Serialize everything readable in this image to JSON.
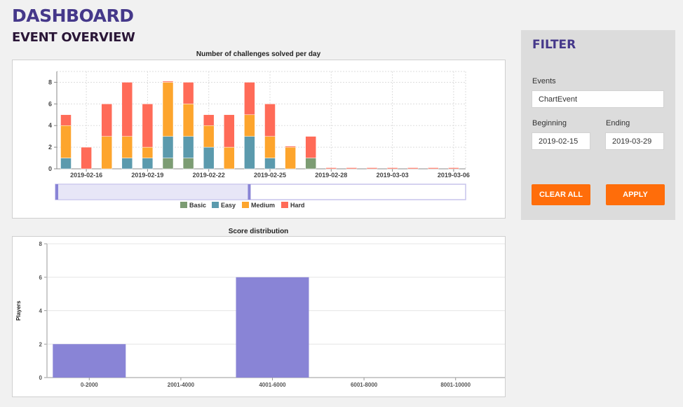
{
  "header": {
    "title": "DASHBOARD",
    "subtitle": "EVENT OVERVIEW"
  },
  "colors": {
    "Basic": "#7c9c73",
    "Easy": "#5b9aad",
    "Medium": "#fda52d",
    "Hard": "#ff6b58",
    "score_bar": "#8984d6",
    "accent": "#45388a",
    "button": "#ff6d0a"
  },
  "chart_data": [
    {
      "type": "bar",
      "stacked": true,
      "title": "Number of challenges solved per day",
      "xlabel": "",
      "ylabel": "",
      "ylim": [
        0,
        9
      ],
      "yticks": [
        0,
        2,
        4,
        6,
        8
      ],
      "grid": true,
      "legend": "bottom",
      "categories": [
        "2019-02-15",
        "2019-02-16",
        "2019-02-17",
        "2019-02-18",
        "2019-02-19",
        "2019-02-20",
        "2019-02-21",
        "2019-02-22",
        "2019-02-23",
        "2019-02-24",
        "2019-02-25",
        "2019-02-26",
        "2019-02-27",
        "2019-02-28",
        "2019-03-01",
        "2019-03-02",
        "2019-03-03",
        "2019-03-04",
        "2019-03-05",
        "2019-03-06"
      ],
      "xticks": [
        "2019-02-16",
        "2019-02-19",
        "2019-02-22",
        "2019-02-25",
        "2019-02-28",
        "2019-03-03",
        "2019-03-06"
      ],
      "series": [
        {
          "name": "Basic",
          "values": [
            0,
            0,
            0,
            0,
            0,
            1,
            1,
            0,
            0,
            0,
            0,
            0,
            1,
            0,
            0,
            0,
            0,
            0,
            0,
            0
          ]
        },
        {
          "name": "Easy",
          "values": [
            1,
            0,
            0,
            1,
            1,
            2,
            2,
            2,
            0,
            3,
            1,
            0,
            0,
            0,
            0,
            0,
            0,
            0,
            0,
            0
          ]
        },
        {
          "name": "Medium",
          "values": [
            3,
            0,
            3,
            2,
            1,
            5,
            3,
            2,
            2,
            2,
            2,
            2,
            0,
            0,
            0,
            0,
            0,
            0,
            0,
            0
          ]
        },
        {
          "name": "Hard",
          "values": [
            1,
            2,
            3,
            5,
            4,
            0.1,
            2,
            1,
            3,
            3,
            3,
            0.1,
            2,
            0.1,
            0.1,
            0.1,
            0.1,
            0.1,
            0.1,
            0.1
          ]
        }
      ],
      "brush_range": [
        "2019-02-15",
        "2019-02-24"
      ]
    },
    {
      "type": "bar",
      "title": "Score distribution",
      "xlabel": "",
      "ylabel": "Players",
      "ylim": [
        0,
        8
      ],
      "yticks": [
        0,
        2,
        4,
        6,
        8
      ],
      "grid": true,
      "categories": [
        "0-2000",
        "2001-4000",
        "4001-6000",
        "6001-8000",
        "8001-10000"
      ],
      "values": [
        2,
        0,
        6,
        0,
        0
      ]
    }
  ],
  "filter": {
    "title": "FILTER",
    "events_label": "Events",
    "events_value": "ChartEvent",
    "beginning_label": "Beginning",
    "beginning_value": "2019-02-15",
    "ending_label": "Ending",
    "ending_value": "2019-03-29",
    "clear_label": "CLEAR ALL",
    "apply_label": "APPLY"
  }
}
